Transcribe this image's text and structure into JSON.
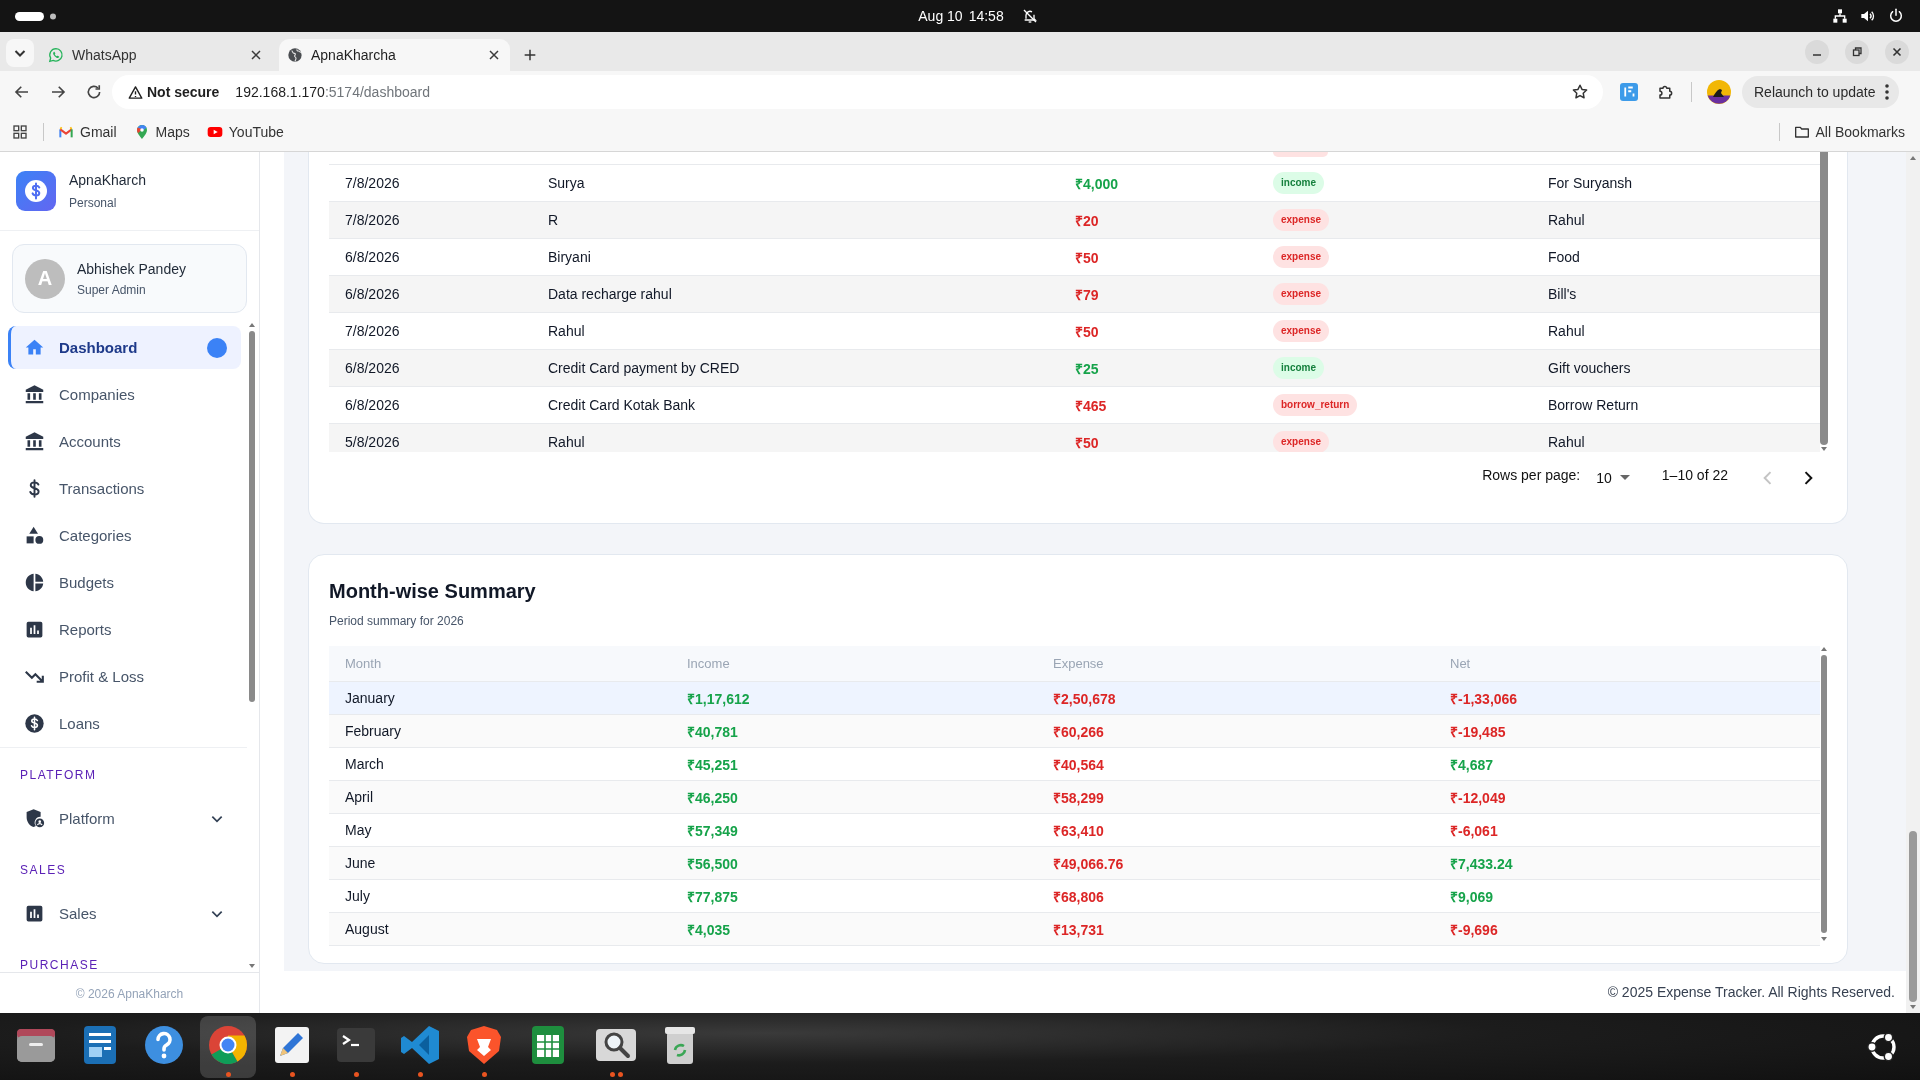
{
  "system_bar": {
    "date": "Aug 10",
    "time": "14:58"
  },
  "browser": {
    "tabs": [
      {
        "title": "WhatsApp",
        "selected": false
      },
      {
        "title": "ApnaKharcha",
        "selected": true
      }
    ],
    "address": {
      "security": "Not secure",
      "host": "192.168.1.170",
      "path": ":5174/dashboard"
    },
    "update_button": "Relaunch to update",
    "bookmarks": [
      "Gmail",
      "Maps",
      "YouTube"
    ],
    "all_bookmarks": "All Bookmarks"
  },
  "sidebar": {
    "brand": {
      "name": "ApnaKharch",
      "subtitle": "Personal"
    },
    "user": {
      "initial": "A",
      "name": "Abhishek Pandey",
      "role": "Super Admin"
    },
    "nav": [
      {
        "label": "Dashboard",
        "selected": true
      },
      {
        "label": "Companies",
        "selected": false
      },
      {
        "label": "Accounts",
        "selected": false
      },
      {
        "label": "Transactions",
        "selected": false
      },
      {
        "label": "Categories",
        "selected": false
      },
      {
        "label": "Budgets",
        "selected": false
      },
      {
        "label": "Reports",
        "selected": false
      },
      {
        "label": "Profit & Loss",
        "selected": false
      },
      {
        "label": "Loans",
        "selected": false
      }
    ],
    "sections": [
      {
        "label": "PLATFORM",
        "items": [
          {
            "label": "Platform",
            "expanded": false
          }
        ]
      },
      {
        "label": "SALES",
        "items": [
          {
            "label": "Sales",
            "expanded": false
          }
        ]
      },
      {
        "label": "PURCHASE"
      }
    ],
    "footer": "© 2026 ApnaKharch"
  },
  "transactions": {
    "rows": [
      {
        "date": "7/8/2026",
        "description": "Surya",
        "amount": "₹4,000",
        "type": "income",
        "category": "For Suryansh",
        "kind": "credit"
      },
      {
        "date": "7/8/2026",
        "description": "R",
        "amount": "₹20",
        "type": "expense",
        "category": "Rahul",
        "kind": "debit"
      },
      {
        "date": "6/8/2026",
        "description": "Biryani",
        "amount": "₹50",
        "type": "expense",
        "category": "Food",
        "kind": "debit"
      },
      {
        "date": "6/8/2026",
        "description": "Data recharge rahul",
        "amount": "₹79",
        "type": "expense",
        "category": "Bill's",
        "kind": "debit"
      },
      {
        "date": "7/8/2026",
        "description": "Rahul",
        "amount": "₹50",
        "type": "expense",
        "category": "Rahul",
        "kind": "debit"
      },
      {
        "date": "6/8/2026",
        "description": "Credit Card payment by CRED",
        "amount": "₹25",
        "type": "income",
        "category": "Gift vouchers",
        "kind": "credit"
      },
      {
        "date": "6/8/2026",
        "description": "Credit Card Kotak Bank",
        "amount": "₹465",
        "type": "borrow_return",
        "category": "Borrow Return",
        "kind": "debit"
      },
      {
        "date": "5/8/2026",
        "description": "Rahul",
        "amount": "₹50",
        "type": "expense",
        "category": "Rahul",
        "kind": "debit"
      }
    ],
    "pagination": {
      "rows_label": "Rows per page:",
      "rows_value": "10",
      "range": "1–10 of 22",
      "prev_disabled": true,
      "next_disabled": false
    }
  },
  "month_summary": {
    "title": "Month-wise Summary",
    "subtitle": "Period summary for 2026",
    "columns": [
      "Month",
      "Income",
      "Expense",
      "Net"
    ],
    "rows": [
      {
        "month": "January",
        "income": "₹1,17,612",
        "expense": "₹2,50,678",
        "net": "₹-1,33,066",
        "kind": "loss",
        "selected": true
      },
      {
        "month": "February",
        "income": "₹40,781",
        "expense": "₹60,266",
        "net": "₹-19,485",
        "kind": "loss",
        "selected": false
      },
      {
        "month": "March",
        "income": "₹45,251",
        "expense": "₹40,564",
        "net": "₹4,687",
        "kind": "gain",
        "selected": false
      },
      {
        "month": "April",
        "income": "₹46,250",
        "expense": "₹58,299",
        "net": "₹-12,049",
        "kind": "loss",
        "selected": false
      },
      {
        "month": "May",
        "income": "₹57,349",
        "expense": "₹63,410",
        "net": "₹-6,061",
        "kind": "loss",
        "selected": false
      },
      {
        "month": "June",
        "income": "₹56,500",
        "expense": "₹49,066.76",
        "net": "₹7,433.24",
        "kind": "gain",
        "selected": false
      },
      {
        "month": "July",
        "income": "₹77,875",
        "expense": "₹68,806",
        "net": "₹9,069",
        "kind": "gain",
        "selected": false
      },
      {
        "month": "August",
        "income": "₹4,035",
        "expense": "₹13,731",
        "net": "₹-9,696",
        "kind": "loss",
        "selected": false
      }
    ]
  },
  "footer": "© 2025 Expense Tracker. All Rights Reserved.",
  "taskbar": {
    "apps": [
      {
        "selected": false,
        "running": false,
        "multiple_windows": false
      },
      {
        "selected": false,
        "running": false,
        "multiple_windows": false
      },
      {
        "selected": false,
        "running": false,
        "multiple_windows": false
      },
      {
        "selected": true,
        "running": true,
        "multiple_windows": false
      },
      {
        "selected": false,
        "running": true,
        "multiple_windows": false
      },
      {
        "selected": false,
        "running": true,
        "multiple_windows": false
      },
      {
        "selected": false,
        "running": true,
        "multiple_windows": false
      },
      {
        "selected": false,
        "running": true,
        "multiple_windows": false
      },
      {
        "selected": false,
        "running": false,
        "multiple_windows": false
      },
      {
        "selected": false,
        "running": true,
        "multiple_windows": true
      },
      {
        "selected": false,
        "running": false,
        "multiple_windows": false
      }
    ]
  }
}
